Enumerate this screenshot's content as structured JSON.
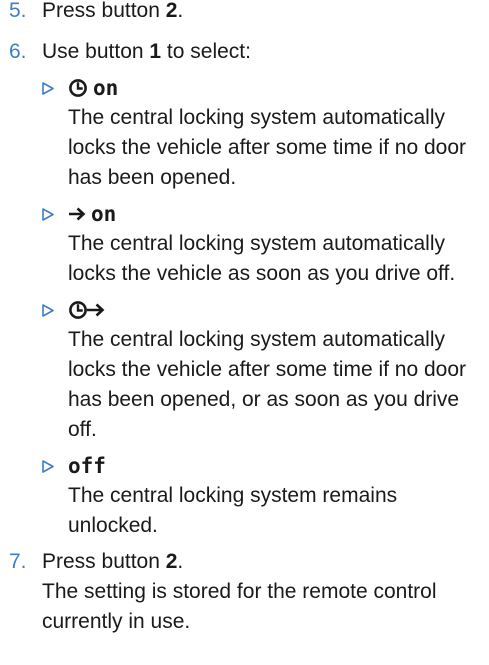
{
  "steps": [
    {
      "number": "5.",
      "pre": "Press button ",
      "button": "2",
      "post": "."
    },
    {
      "number": "6.",
      "pre": "Use button ",
      "button": "1",
      "post": " to select:",
      "options": [
        {
          "icon": "clock-icon",
          "title": "on",
          "description": "The central locking system automatically locks the vehicle after some time if no door has been opened."
        },
        {
          "icon": "arrow-right-icon",
          "title": "on",
          "description": "The central locking system automatically locks the vehicle as soon as you drive off."
        },
        {
          "icon": "clock-arrow-icon",
          "title": "",
          "description": "The central locking system automatically locks the vehicle after some time if no door has been opened, or as soon as you drive off."
        },
        {
          "icon": "",
          "title": "off",
          "description": "The central locking system remains unlocked."
        }
      ]
    },
    {
      "number": "7.",
      "pre": "Press button ",
      "button": "2",
      "post": ".",
      "note": "The setting is stored for the remote control currently in use."
    }
  ],
  "colors": {
    "accent": "#3d7fc4",
    "text": "#1a1a1a"
  }
}
